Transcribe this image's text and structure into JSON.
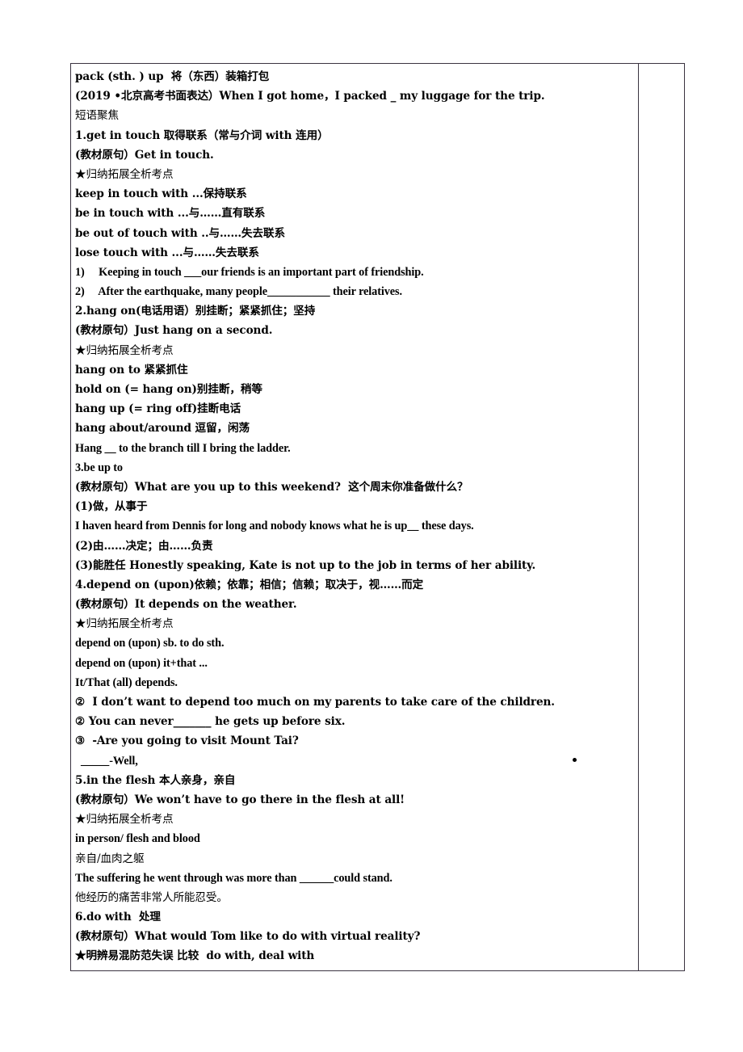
{
  "document": {
    "title": "pack (sth. ) up 将（东西）装箱打包",
    "column_count": 2,
    "border_color": "#3a3340",
    "stray_bullet_glyph": "•"
  },
  "lines": [
    {
      "id": "l01",
      "text": "pack (sth. ) up  将（东西）装箱打包",
      "style": "cjkb"
    },
    {
      "id": "l02",
      "text": "(2019 •北京高考书面表达）When I got home，I packed _ my luggage for the trip.",
      "style": "cjkb"
    },
    {
      "id": "l03",
      "text": "短语聚焦",
      "style": "cjk"
    },
    {
      "id": "l04",
      "text": "1.get in touch 取得联系（常与介词 with 连用）",
      "style": "cjkb"
    },
    {
      "id": "l05",
      "text": "(教材原句）Get in touch.",
      "style": "cjkb"
    },
    {
      "id": "l06",
      "text": "★归纳拓展全析考点",
      "style": "cjk"
    },
    {
      "id": "l07",
      "text": "keep in touch with ...保持联系",
      "style": "cjkb"
    },
    {
      "id": "l08",
      "text": "be in touch with ...与……直有联系",
      "style": "cjkb"
    },
    {
      "id": "l09",
      "text": "be out of touch with ..与……失去联系",
      "style": "cjkb"
    },
    {
      "id": "l10",
      "text": "lose touch with ...与……失去联系",
      "style": "cjkb"
    },
    {
      "id": "l11",
      "text": "1)     Keeping in touch ___our friends is an important part of friendship.",
      "style": "b"
    },
    {
      "id": "l12",
      "text": "2)     After the earthquake, many people___________ their relatives.",
      "style": "b"
    },
    {
      "id": "l13",
      "text": "2.hang on(电话用语）别挂断；紧紧抓住；坚持",
      "style": "cjkb"
    },
    {
      "id": "l14",
      "text": "(教材原句）Just hang on a second.",
      "style": "cjkb"
    },
    {
      "id": "l15",
      "text": "★归纳拓展全析考点",
      "style": "cjk"
    },
    {
      "id": "l16",
      "text": "hang on to 紧紧抓住",
      "style": "cjkb"
    },
    {
      "id": "l17",
      "text": "hold on (= hang on)别挂断，稍等",
      "style": "cjkb"
    },
    {
      "id": "l18",
      "text": "hang up (= ring off)挂断电话",
      "style": "cjkb"
    },
    {
      "id": "l19",
      "text": "hang about/around 逗留，闲荡",
      "style": "cjkb"
    },
    {
      "id": "l20",
      "text": "Hang __ to the branch till I bring the ladder.",
      "style": "b"
    },
    {
      "id": "l21",
      "text": "3.be up to",
      "style": "b"
    },
    {
      "id": "l22",
      "text": "(教材原句）What are you up to this weekend?  这个周末你准备做什么？",
      "style": "cjkb"
    },
    {
      "id": "l23",
      "text": "(1)做，从事于",
      "style": "cjkb"
    },
    {
      "id": "l24",
      "text": "I haven heard from Dennis for long and nobody knows what he is up__ these days.",
      "style": "b"
    },
    {
      "id": "l25",
      "text": "(2)由……决定；由……负责",
      "style": "cjkb"
    },
    {
      "id": "l26",
      "text": "(3)能胜任 Honestly speaking, Kate is not up to the job in terms of her ability.",
      "style": "cjkb"
    },
    {
      "id": "l27",
      "text": "4.depend on (upon)依赖；依靠；相信；信赖；取决于，视……而定",
      "style": "cjkb"
    },
    {
      "id": "l28",
      "text": "(教材原句）It depends on the weather.",
      "style": "cjkb"
    },
    {
      "id": "l29",
      "text": "★归纳拓展全析考点",
      "style": "cjk"
    },
    {
      "id": "l30",
      "text": "depend on (upon) sb. to do sth.",
      "style": "b"
    },
    {
      "id": "l31",
      "text": "depend on (upon) it+that ...",
      "style": "b"
    },
    {
      "id": "l32",
      "text": "It/That (all) depends.",
      "style": "b"
    },
    {
      "id": "l33",
      "text": "②  I don’t want to depend too much on my parents to take care of the children.",
      "style": "cjkb"
    },
    {
      "id": "l34",
      "text": "② You can never_______ he gets up before six.",
      "style": "cjkb"
    },
    {
      "id": "l35",
      "text": "③  -Are you going to visit Mount Tai?",
      "style": "cjkb"
    },
    {
      "id": "l36",
      "text": "  _____-Well,",
      "style": "b",
      "has_stray_bullet": true
    },
    {
      "id": "l37",
      "text": "5.in the flesh 本人亲身，亲自",
      "style": "cjkb"
    },
    {
      "id": "l38",
      "text": "(教材原句）We won’t have to go there in the flesh at all!",
      "style": "cjkb"
    },
    {
      "id": "l39",
      "text": "★归纳拓展全析考点",
      "style": "cjk"
    },
    {
      "id": "l40",
      "text": "in person/ flesh and blood",
      "style": "b"
    },
    {
      "id": "l41",
      "text": "亲自/血肉之躯",
      "style": "cjk"
    },
    {
      "id": "l42",
      "text": "The suffering he went through was more than ______could stand.",
      "style": "b"
    },
    {
      "id": "l43",
      "text": "他经历的痛苦非常人所能忍受。",
      "style": "cjk"
    },
    {
      "id": "l44",
      "text": "6.do with  处理",
      "style": "cjkb"
    },
    {
      "id": "l45",
      "text": "(教材原句）What would Tom like to do with virtual reality?",
      "style": "cjkb"
    },
    {
      "id": "l46",
      "text": "★明辨易混防范失误 比较  do with, deal with",
      "style": "cjkb"
    }
  ]
}
